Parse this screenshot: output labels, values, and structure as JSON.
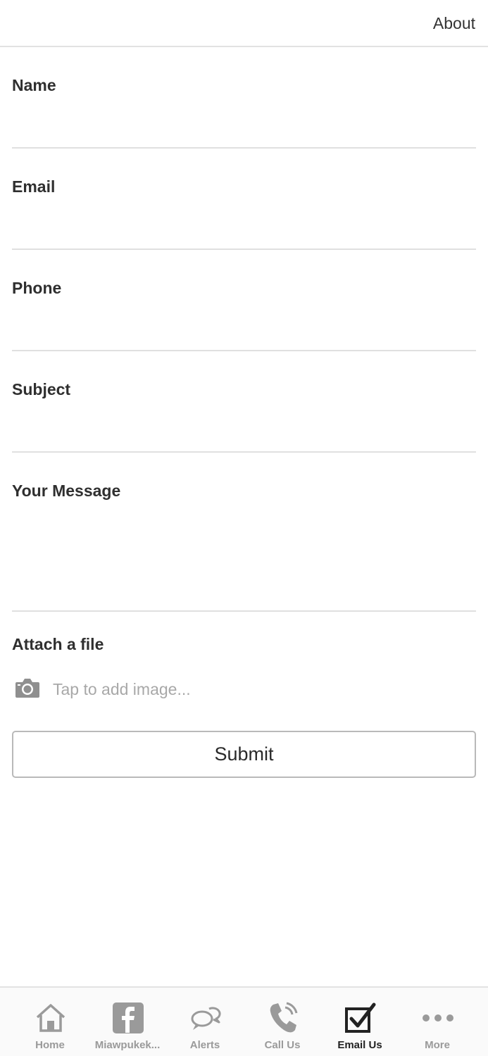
{
  "header": {
    "about_label": "About"
  },
  "form": {
    "fields": [
      {
        "label": "Name",
        "value": ""
      },
      {
        "label": "Email",
        "value": ""
      },
      {
        "label": "Phone",
        "value": ""
      },
      {
        "label": "Subject",
        "value": ""
      },
      {
        "label": "Your Message",
        "value": ""
      }
    ],
    "attach": {
      "label": "Attach a file",
      "hint": "Tap to add image...",
      "icon": "camera-icon"
    },
    "submit_label": "Submit"
  },
  "tabbar": {
    "tabs": [
      {
        "label": "Home",
        "icon": "home-icon",
        "active": false
      },
      {
        "label": "Miawpukek...",
        "icon": "facebook-icon",
        "active": false
      },
      {
        "label": "Alerts",
        "icon": "chat-bubbles-icon",
        "active": false
      },
      {
        "label": "Call Us",
        "icon": "phone-icon",
        "active": false
      },
      {
        "label": "Email Us",
        "icon": "checkbox-icon",
        "active": true
      },
      {
        "label": "More",
        "icon": "more-dots-icon",
        "active": false
      }
    ]
  },
  "colors": {
    "inactive_tab": "#9a9a9a",
    "active_tab": "#222222",
    "divider": "#e0e0e0",
    "hint": "#a8a8a8"
  }
}
